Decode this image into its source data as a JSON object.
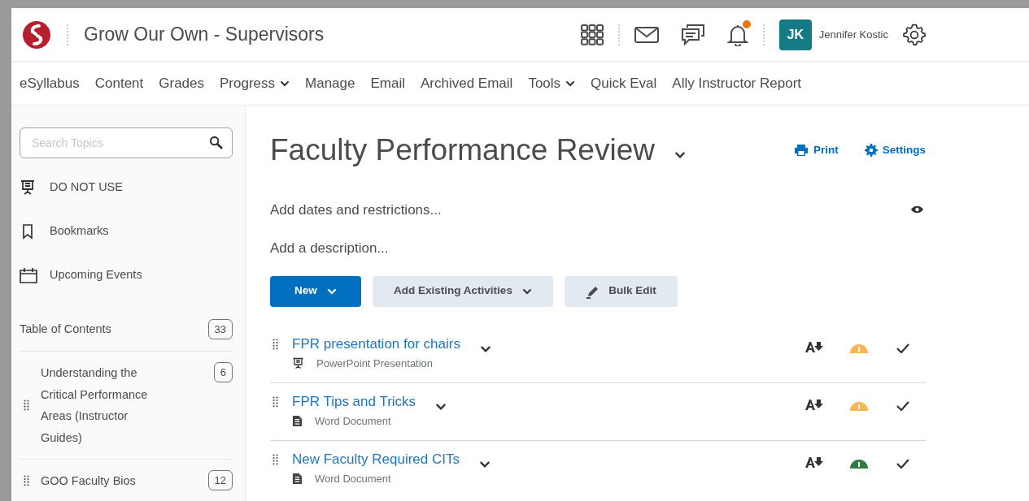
{
  "header": {
    "course_title": "Grow Our Own - Supervisors",
    "user_initials": "JK",
    "user_name": "Jennifer Kostic",
    "notification_badge": true
  },
  "nav": [
    {
      "label": "eSyllabus",
      "dropdown": false
    },
    {
      "label": "Content",
      "dropdown": false
    },
    {
      "label": "Grades",
      "dropdown": false
    },
    {
      "label": "Progress",
      "dropdown": true
    },
    {
      "label": "Manage",
      "dropdown": false
    },
    {
      "label": "Email",
      "dropdown": false
    },
    {
      "label": "Archived Email",
      "dropdown": false
    },
    {
      "label": "Tools",
      "dropdown": true
    },
    {
      "label": "Quick Eval",
      "dropdown": false
    },
    {
      "label": "Ally Instructor Report",
      "dropdown": false
    }
  ],
  "sidebar": {
    "search": {
      "placeholder": "Search Topics"
    },
    "items": [
      {
        "kind": "presentation",
        "label": "DO NOT USE"
      },
      {
        "kind": "bookmark",
        "label": "Bookmarks"
      },
      {
        "kind": "calendar",
        "label": "Upcoming Events"
      }
    ],
    "toc": {
      "label": "Table of Contents",
      "count": "33"
    },
    "modules": [
      {
        "label": "Understanding the Critical Performance Areas (Instructor Guides)",
        "count": "6"
      },
      {
        "label": "GOO Faculty Bios",
        "count": "12"
      }
    ]
  },
  "main": {
    "title": "Faculty Performance Review",
    "print": "Print",
    "settings": "Settings",
    "dates": "Add dates and restrictions...",
    "description": "Add a description...",
    "buttons": [
      {
        "kind": "primary",
        "label": "New"
      },
      {
        "kind": "dropdown",
        "label": "Add Existing Activities"
      },
      {
        "kind": "edit",
        "label": "Bulk Edit"
      }
    ],
    "activities": [
      {
        "title": "FPR presentation for chairs",
        "type": "PowerPoint Presentation",
        "kind": "presentation",
        "color": "#f8b552"
      },
      {
        "title": "FPR Tips and Tricks",
        "type": "Word Document",
        "kind": "document",
        "color": "#f8b552"
      },
      {
        "title": "New Faculty Required CITs",
        "type": "Word Document",
        "kind": "document",
        "color": "#2e7d43"
      }
    ]
  }
}
